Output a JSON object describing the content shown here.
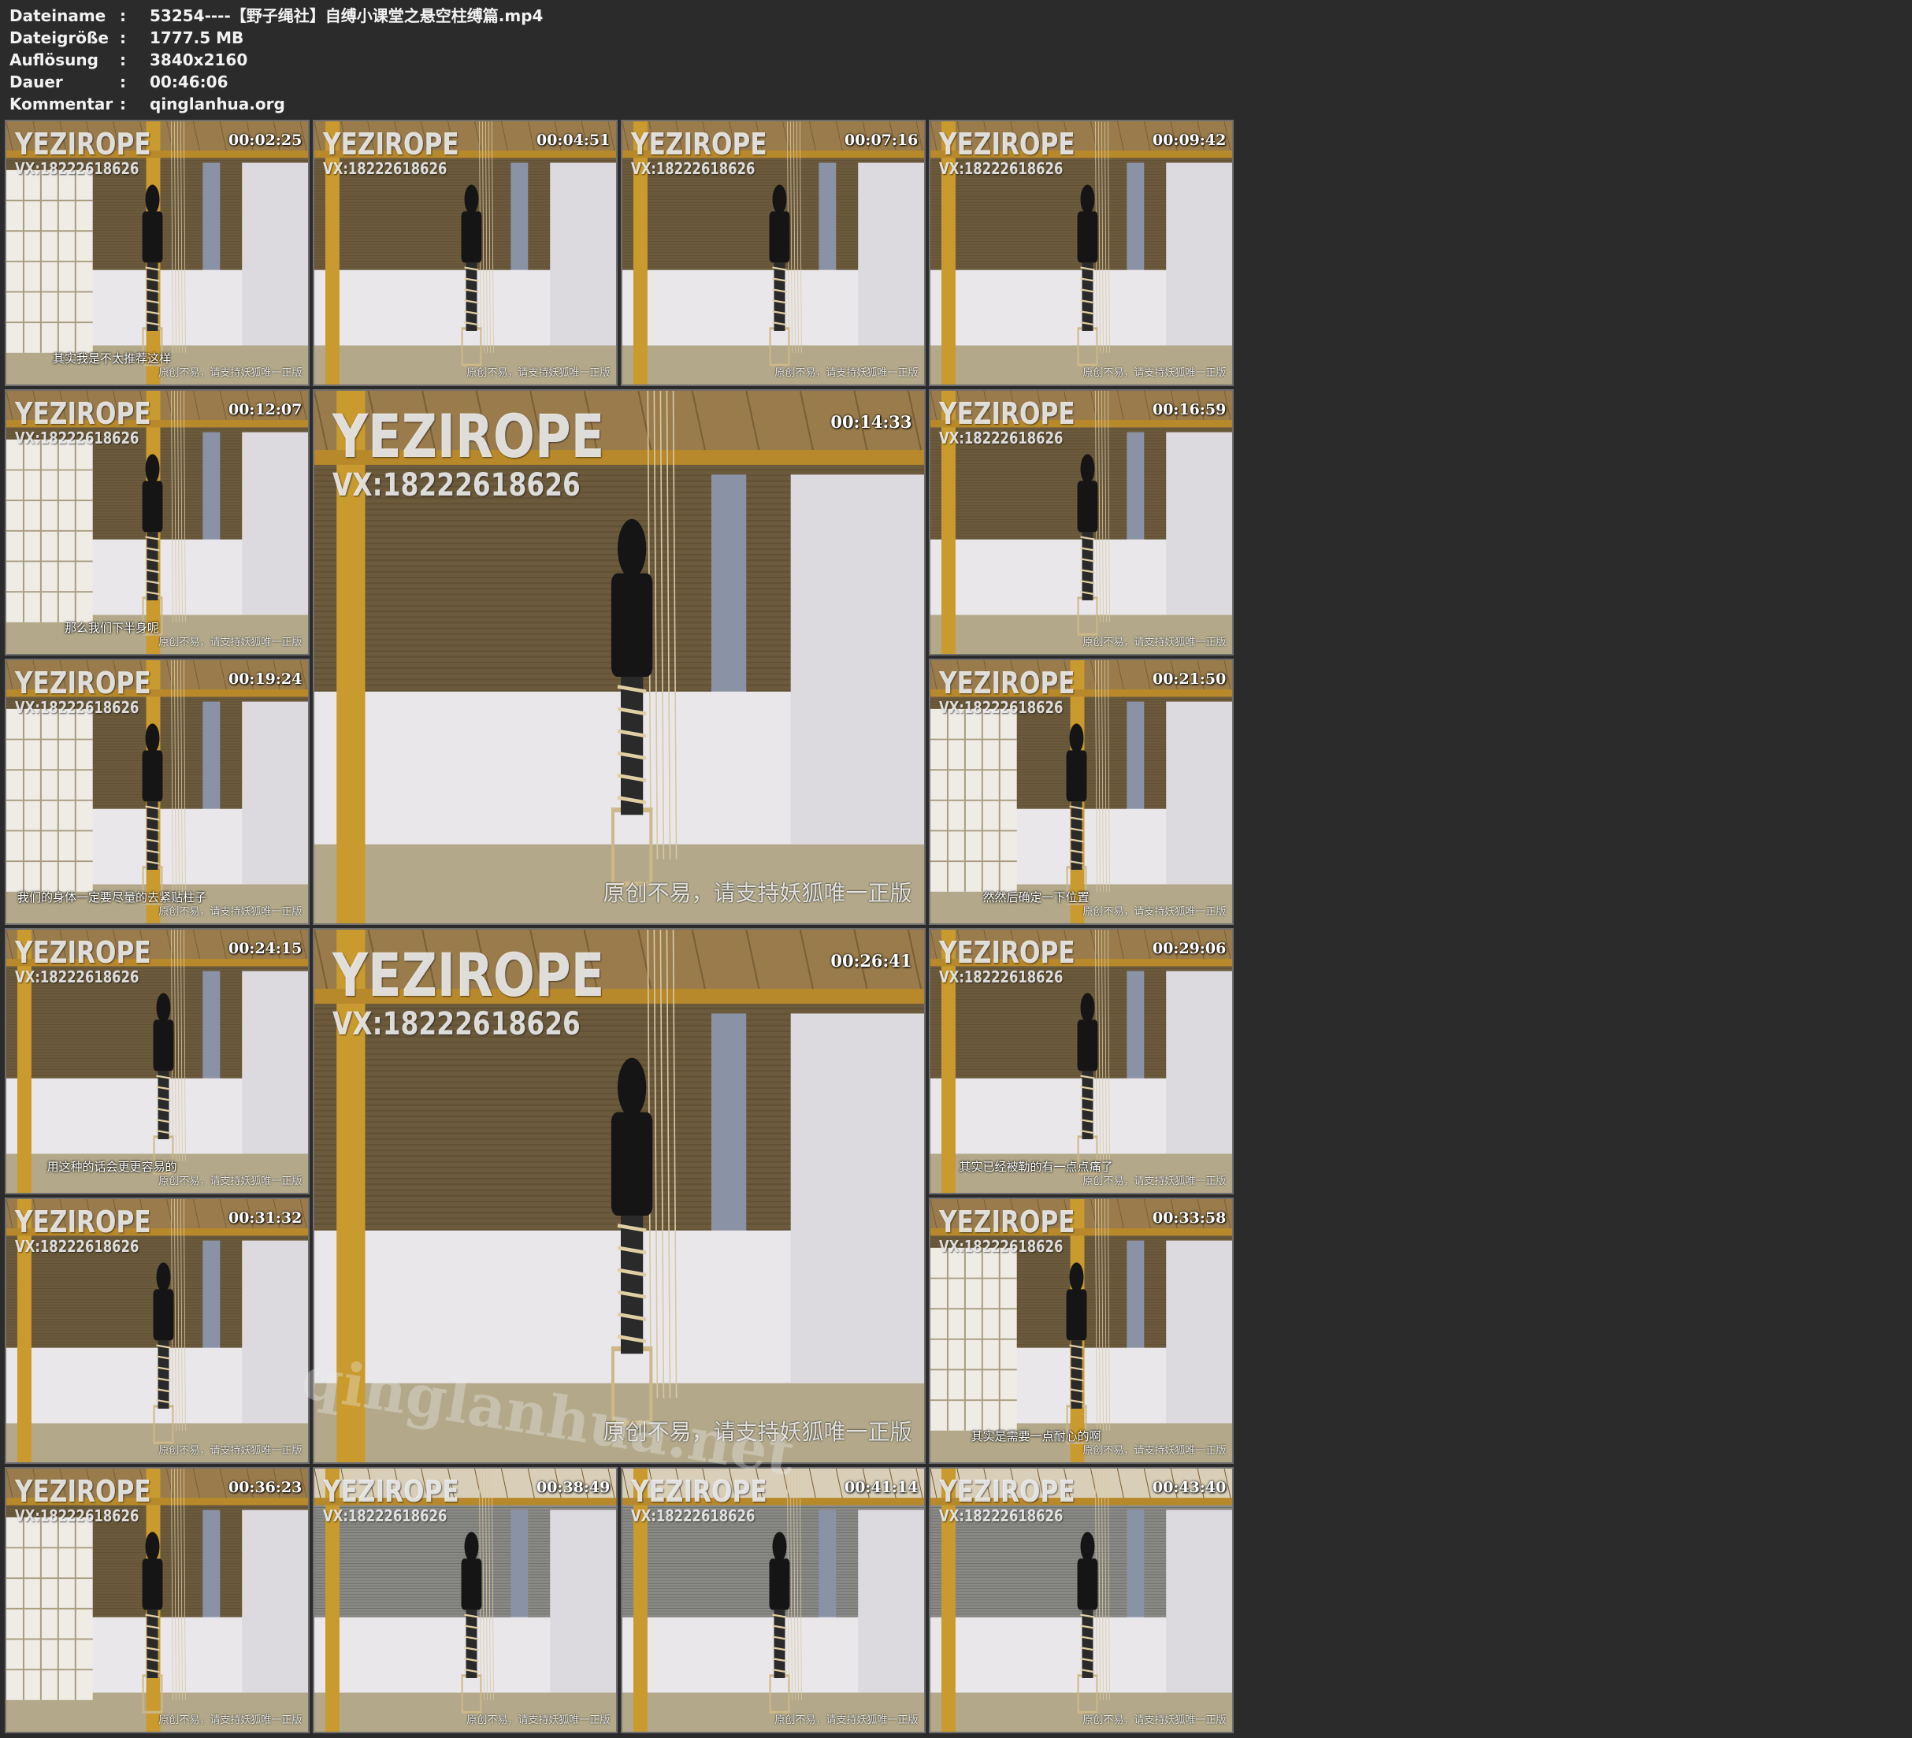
{
  "header": {
    "rows": [
      {
        "label": "Dateiname",
        "value": "53254----【野子绳社】自缚小课堂之悬空柱缚篇.mp4"
      },
      {
        "label": "Dateigröße",
        "value": "1777.5 MB"
      },
      {
        "label": "Auflösung",
        "value": "3840x2160"
      },
      {
        "label": "Dauer",
        "value": "00:46:06"
      },
      {
        "label": "Kommentar",
        "value": "qinglanhua.org"
      }
    ]
  },
  "logo": {
    "line1": "YEZIROPE",
    "line2": "VX:18222618626"
  },
  "watermark": "qinglanhua.net",
  "credit": "原创不易，请支持妖狐唯一正版",
  "thumbs": [
    {
      "time": "00:02:25",
      "subtitle": "其实我是不太推荐这样",
      "credit": true,
      "scene": "lean"
    },
    {
      "time": "00:04:51",
      "subtitle": "",
      "credit": true,
      "scene": "stand"
    },
    {
      "time": "00:07:16",
      "subtitle": "",
      "credit": true,
      "scene": "stand"
    },
    {
      "time": "00:09:42",
      "subtitle": "",
      "credit": true,
      "scene": "stand"
    },
    {
      "time": "00:12:07",
      "subtitle": "那么我们下半身呢",
      "credit": true,
      "scene": "lean"
    },
    {
      "time": "00:14:33",
      "subtitle": "",
      "credit": true,
      "scene": "stand",
      "big": true
    },
    {
      "time": "00:16:59",
      "subtitle": "",
      "credit": true,
      "scene": "stand"
    },
    {
      "time": "00:19:24",
      "subtitle": "我们的身体一定要尽量的去紧贴柱子",
      "credit": true,
      "scene": "lean"
    },
    {
      "time": "00:21:50",
      "subtitle": "然然后确定一下位置",
      "credit": true,
      "scene": "lean"
    },
    {
      "time": "00:24:15",
      "subtitle": "用这种的话会更更容易的",
      "credit": true,
      "scene": "stand"
    },
    {
      "time": "00:26:41",
      "subtitle": "",
      "credit": true,
      "scene": "stand",
      "big": true
    },
    {
      "time": "00:29:06",
      "subtitle": "其实已经被勒的有一点点痛了",
      "credit": true,
      "scene": "stand"
    },
    {
      "time": "00:31:32",
      "subtitle": "",
      "credit": true,
      "scene": "stand"
    },
    {
      "time": "00:33:58",
      "subtitle": "其实是需要一点耐心的啊",
      "credit": true,
      "scene": "lean"
    },
    {
      "time": "00:36:23",
      "subtitle": "",
      "credit": true,
      "scene": "lean"
    },
    {
      "time": "00:38:49",
      "subtitle": "",
      "credit": true,
      "scene": "bright"
    },
    {
      "time": "00:41:14",
      "subtitle": "",
      "credit": true,
      "scene": "bright"
    },
    {
      "time": "00:43:40",
      "subtitle": "",
      "credit": true,
      "scene": "bright"
    }
  ],
  "colors": {
    "background": "#2b2b2b",
    "wall": "#e9e7ea",
    "blind": "#6b5a3c",
    "pillar": "#c99a2e",
    "floor": "#b3a98a",
    "figure": "#151515"
  }
}
